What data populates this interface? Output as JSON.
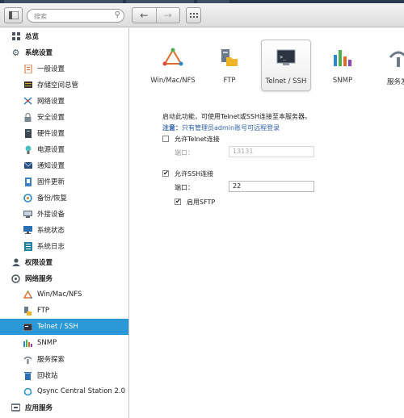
{
  "toolbar": {
    "search_placeholder": "搜索",
    "back_glyph": "←",
    "forward_glyph": "→"
  },
  "sidebar": {
    "overview": "总览",
    "system_settings": "系统设置",
    "general": "一般设置",
    "storage": "存储空间总管",
    "network": "网络设置",
    "security": "安全设置",
    "hardware": "硬件设置",
    "power": "电源设置",
    "notification": "通知设置",
    "firmware": "固件更新",
    "backup": "备份/恢复",
    "external": "外接设备",
    "status": "系统状态",
    "logs": "系统日志",
    "privileges": "权限设置",
    "network_services": "网络服务",
    "win_mac_nfs": "Win/Mac/NFS",
    "ftp": "FTP",
    "telnet_ssh": "Telnet / SSH",
    "snmp": "SNMP",
    "service_discovery": "服务探索",
    "recycle": "回收站",
    "qsync": "Qsync Central Station 2.0",
    "app_services": "应用服务"
  },
  "tabs": {
    "win_mac_nfs": "Win/Mac/NFS",
    "ftp": "FTP",
    "telnet_ssh": "Telnet / SSH",
    "snmp": "SNMP",
    "service_partial": "服务发"
  },
  "form": {
    "intro": "启动此功能，可使用Telnet或SSH连接至本服务器。",
    "note_label": "注意：",
    "note_text": "只有管理员admin账号可远程登录",
    "allow_telnet": "允许Telnet连接",
    "telnet_port_label": "端口：",
    "telnet_port_value": "13131",
    "allow_ssh": "允许SSH连接",
    "ssh_port_label": "端口：",
    "ssh_port_value": "22",
    "enable_sftp": "启用SFTP",
    "checked_mark": "✔"
  },
  "colors": {
    "active": "#2a98d6",
    "note": "#2d5ea8"
  }
}
